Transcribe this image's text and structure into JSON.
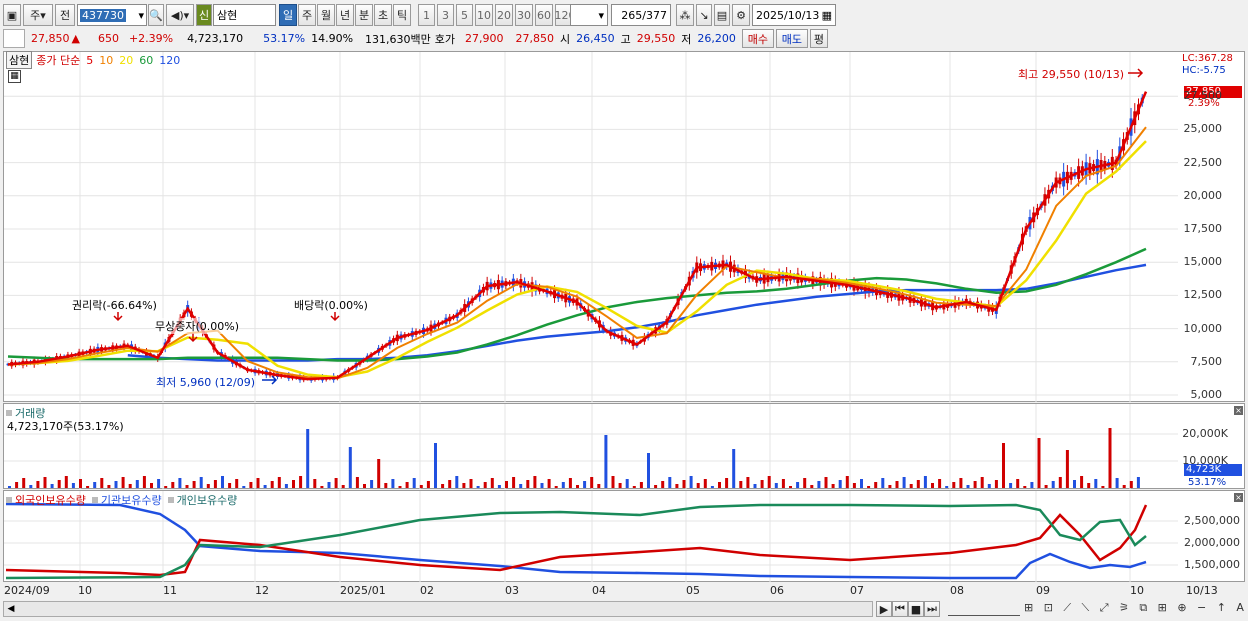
{
  "toolbar": {
    "market": "주",
    "prev": "전",
    "code": "437730",
    "name": "삼현",
    "shin": "신",
    "periods": [
      "일",
      "주",
      "월",
      "년",
      "분",
      "초",
      "틱"
    ],
    "intervals": [
      "1",
      "3",
      "5",
      "10",
      "20",
      "30",
      "60",
      "120"
    ],
    "count": "265",
    "total": "/377",
    "date": "2025/10/13"
  },
  "quote": {
    "price": "27,850",
    "change": "650",
    "rate": "+2.39%",
    "volume": "4,723,170",
    "vol_ratio": "53.17%",
    "turnover": "14.90%",
    "amount": "131,630백만",
    "bid_label": "호가",
    "ask": "27,900",
    "bid": "27,850",
    "open_label": "시",
    "open": "26,450",
    "high_label": "고",
    "high": "29,550",
    "low_label": "저",
    "low": "26,200",
    "buy": "매수",
    "sell": "매도",
    "eval": "평"
  },
  "price_panel": {
    "legend_name": "삼현",
    "legend_title": "종가 단순",
    "ma": [
      {
        "label": "5",
        "color": "#e00000"
      },
      {
        "label": "10",
        "color": "#f08000"
      },
      {
        "label": "20",
        "color": "#f0e000"
      },
      {
        "label": "60",
        "color": "#1a9a3a"
      },
      {
        "label": "120",
        "color": "#2050e0"
      }
    ],
    "lc": "LC:367.28",
    "hc": "HC:-5.75",
    "cur_price": "27,850",
    "cur_rate": "2.39%",
    "high_note": "최고 29,550 (10/13)",
    "low_note": "최저 5,960 (12/09)",
    "events": [
      "권리락(-66.64%)",
      "무상증자(0.00%)",
      "배당락(0.00%)"
    ],
    "yticks": [
      "27,500",
      "25,000",
      "22,500",
      "20,000",
      "17,500",
      "15,000",
      "12,500",
      "10,000",
      "7,500",
      "5,000"
    ]
  },
  "volume_panel": {
    "title": "거래량",
    "value": "4,723,170주(53.17%)",
    "yticks": [
      "20,000K",
      "10,000K"
    ],
    "cur": "4,723K",
    "cur_rate": "53.17%"
  },
  "holder_panel": {
    "series": [
      "외국인보유수량",
      "기관보유수량",
      "개인보유수량"
    ],
    "yticks": [
      "2,500,000",
      "2,000,000",
      "1,500,000"
    ]
  },
  "xaxis": [
    "2024/09",
    "10",
    "11",
    "12",
    "2025/01",
    "02",
    "03",
    "04",
    "05",
    "06",
    "07",
    "08",
    "09",
    "10",
    "10/13"
  ],
  "chart_data": {
    "type": "line",
    "title": "",
    "xlabel": "",
    "ylabel": "",
    "ylim": [
      5000,
      29550
    ],
    "months": [
      "2024/09",
      "10",
      "11",
      "12",
      "2025/01",
      "02",
      "03",
      "04",
      "05",
      "06",
      "07",
      "08",
      "09",
      "10"
    ],
    "series": [
      {
        "name": "종가",
        "values": [
          7300,
          7500,
          7900,
          8400,
          8700,
          7800,
          11500,
          8200,
          6900,
          6500,
          6200,
          6300,
          7800,
          9300,
          9900,
          11000,
          13200,
          13500,
          12800,
          12000,
          9800,
          8800,
          10500,
          14600,
          14800,
          13700,
          13900,
          13600,
          13300,
          12800,
          12300,
          11600,
          12000,
          11400,
          17500,
          21000,
          22000,
          22500,
          27850
        ]
      },
      {
        "name": "120",
        "values": [
          9400,
          9000,
          8600,
          8300,
          8000,
          7800,
          7700,
          7600,
          7600,
          7600,
          7600,
          7700,
          7700,
          7800,
          8000,
          8300,
          8700,
          9100,
          9400,
          9600,
          9800,
          10100,
          10500,
          11000,
          11400,
          11800,
          12100,
          12400,
          12600,
          12800,
          12900,
          12900,
          12900,
          12900,
          13000,
          13400,
          13900,
          14400,
          14800
        ]
      },
      {
        "name": "60",
        "values": [
          7900,
          7800,
          7700,
          7700,
          7700,
          7700,
          7800,
          7800,
          7800,
          7800,
          7700,
          7600,
          7600,
          7700,
          7900,
          8200,
          8800,
          9500,
          10300,
          11000,
          11600,
          12000,
          12300,
          12500,
          12700,
          12800,
          13000,
          13300,
          13600,
          13800,
          13700,
          13400,
          13000,
          12700,
          12800,
          13300,
          14100,
          15000,
          16000
        ]
      }
    ],
    "volume": {
      "unit": "K",
      "ylim": [
        0,
        25000
      ]
    },
    "holders": {
      "series": [
        "외국인보유수량",
        "기관보유수량",
        "개인보유수량"
      ],
      "ylim": [
        1200000,
        3000000
      ]
    }
  }
}
